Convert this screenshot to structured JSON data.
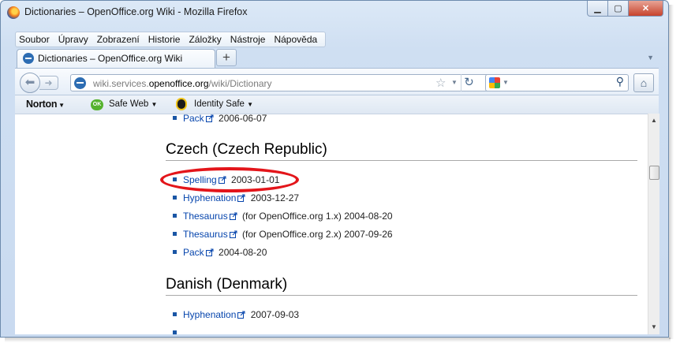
{
  "window": {
    "title": "Dictionaries – OpenOffice.org Wiki - Mozilla Firefox"
  },
  "menu": [
    {
      "label": "Soubor"
    },
    {
      "label": "Úpravy"
    },
    {
      "label": "Zobrazení"
    },
    {
      "label": "Historie"
    },
    {
      "label": "Záložky"
    },
    {
      "label": "Nástroje"
    },
    {
      "label": "Nápověda"
    }
  ],
  "tab": {
    "label": "Dictionaries – OpenOffice.org Wiki"
  },
  "url": {
    "prefix": "wiki.services.",
    "domain": "openoffice.org",
    "path": "/wiki/Dictionary"
  },
  "norton": {
    "brand": "Norton",
    "ok_badge": "OK",
    "safe_web": "Safe Web",
    "identity_safe": "Identity Safe"
  },
  "page": {
    "top_item": {
      "link": "Pack",
      "text": " 2006-06-07"
    },
    "sections": [
      {
        "heading": "Czech (Czech Republic)",
        "items": [
          {
            "link": "Spelling",
            "text": " 2003-01-01"
          },
          {
            "link": "Hyphenation",
            "text": " 2003-12-27"
          },
          {
            "link": "Thesaurus",
            "text": " (for OpenOffice.org 1.x) 2004-08-20"
          },
          {
            "link": "Thesaurus",
            "text": " (for OpenOffice.org 2.x) 2007-09-26"
          },
          {
            "link": "Pack",
            "text": " 2004-08-20"
          }
        ]
      },
      {
        "heading": "Danish (Denmark)",
        "items": [
          {
            "link": "Hyphenation",
            "text": " 2007-09-03"
          }
        ]
      }
    ]
  },
  "colors": {
    "link": "#0645ad",
    "highlight": "#e3151a",
    "bullet": "#1a56a5"
  }
}
